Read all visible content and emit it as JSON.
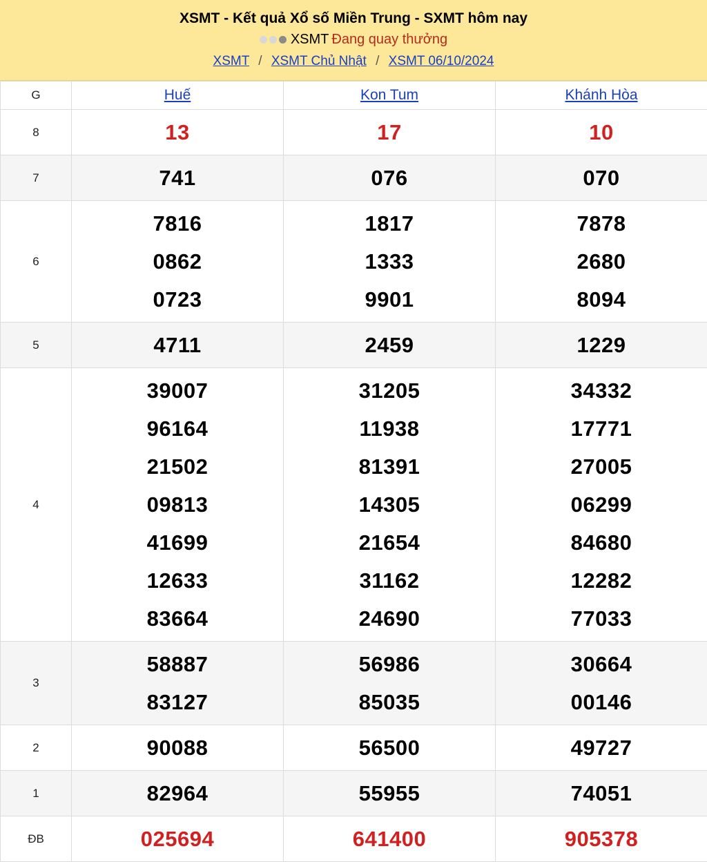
{
  "header": {
    "title": "XSMT - Kết quả Xổ số Miền Trung - SXMT hôm nay",
    "status_prefix": "XSMT",
    "status_text": "Đang quay thưởng",
    "breadcrumbs": [
      "XSMT",
      "XSMT Chủ Nhật",
      "XSMT 06/10/2024"
    ],
    "separator": "/"
  },
  "table": {
    "label_header": "G",
    "provinces": [
      "Huế",
      "Kon Tum",
      "Khánh Hòa"
    ],
    "rows": [
      {
        "label": "8",
        "red": true,
        "values": [
          [
            "13"
          ],
          [
            "17"
          ],
          [
            "10"
          ]
        ]
      },
      {
        "label": "7",
        "values": [
          [
            "741"
          ],
          [
            "076"
          ],
          [
            "070"
          ]
        ]
      },
      {
        "label": "6",
        "values": [
          [
            "7816",
            "0862",
            "0723"
          ],
          [
            "1817",
            "1333",
            "9901"
          ],
          [
            "7878",
            "2680",
            "8094"
          ]
        ]
      },
      {
        "label": "5",
        "values": [
          [
            "4711"
          ],
          [
            "2459"
          ],
          [
            "1229"
          ]
        ]
      },
      {
        "label": "4",
        "values": [
          [
            "39007",
            "96164",
            "21502",
            "09813",
            "41699",
            "12633",
            "83664"
          ],
          [
            "31205",
            "11938",
            "81391",
            "14305",
            "21654",
            "31162",
            "24690"
          ],
          [
            "34332",
            "17771",
            "27005",
            "06299",
            "84680",
            "12282",
            "77033"
          ]
        ]
      },
      {
        "label": "3",
        "values": [
          [
            "58887",
            "83127"
          ],
          [
            "56986",
            "85035"
          ],
          [
            "30664",
            "00146"
          ]
        ]
      },
      {
        "label": "2",
        "values": [
          [
            "90088"
          ],
          [
            "56500"
          ],
          [
            "49727"
          ]
        ]
      },
      {
        "label": "1",
        "values": [
          [
            "82964"
          ],
          [
            "55955"
          ],
          [
            "74051"
          ]
        ]
      },
      {
        "label": "ĐB",
        "red": true,
        "values": [
          [
            "025694"
          ],
          [
            "641400"
          ],
          [
            "905378"
          ]
        ]
      }
    ]
  },
  "colors": {
    "accent_red": "#d21f1f",
    "link_blue": "#1a3fbf",
    "header_bg": "#fde89a"
  }
}
